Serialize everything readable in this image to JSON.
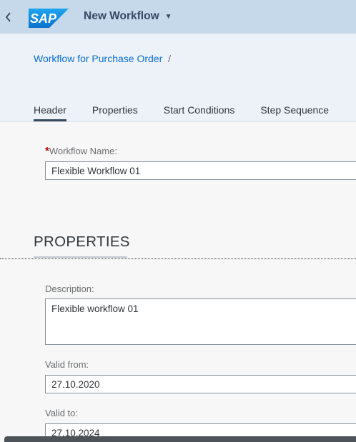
{
  "shellbar": {
    "logo_text": "SAP",
    "app_title": "New Workflow",
    "back_icon": "chevron-left-icon",
    "title_menu_icon": "caret-down-icon"
  },
  "breadcrumb": {
    "link": "Workflow for Purchase Order",
    "separator": "/"
  },
  "tabs": [
    {
      "label": "Header",
      "active": true
    },
    {
      "label": "Properties",
      "active": false
    },
    {
      "label": "Start Conditions",
      "active": false
    },
    {
      "label": "Step Sequence",
      "active": false
    }
  ],
  "header_section": {
    "required_mark": "*",
    "workflow_name_label": "Workflow Name:",
    "workflow_name_value": "Flexible Workflow 01"
  },
  "properties_section": {
    "title": "PROPERTIES",
    "description_label": "Description:",
    "description_value": "Flexible workflow 01",
    "valid_from_label": "Valid from:",
    "valid_from_value": "27.10.2020",
    "valid_to_label": "Valid to:",
    "valid_to_value": "27.10.2024"
  },
  "colors": {
    "shellbar_bg": "#c5d9eb",
    "header_bg": "#edf2f8",
    "link": "#0a6ed1",
    "required": "#bb0000"
  }
}
